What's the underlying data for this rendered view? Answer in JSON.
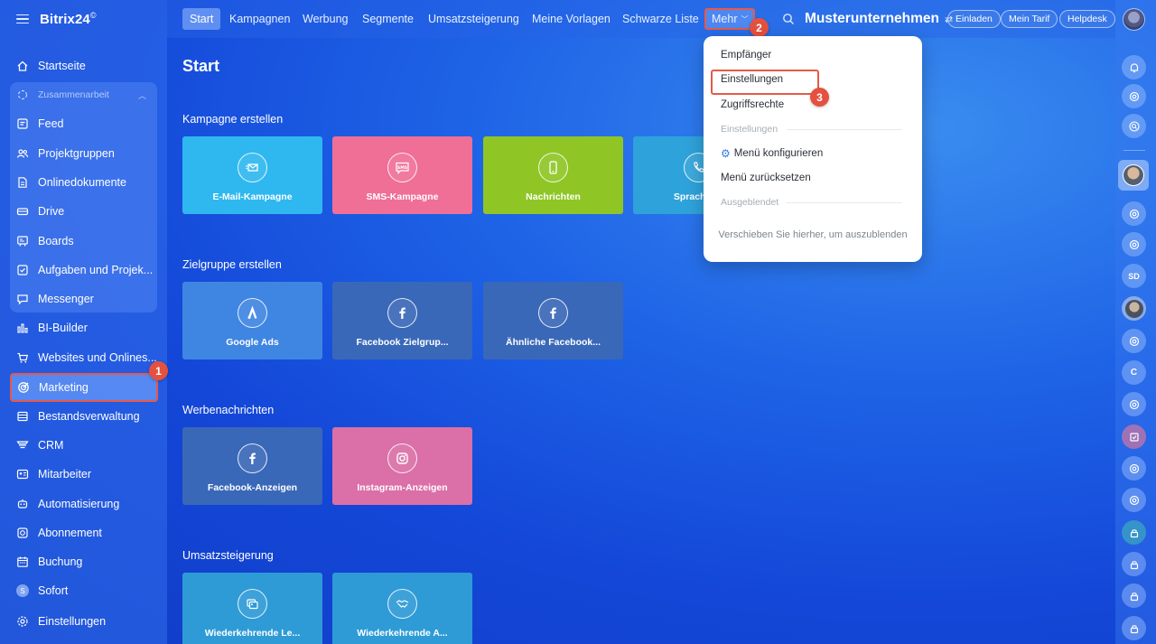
{
  "app": {
    "logo": "Bitrix24",
    "logo_mark": "©"
  },
  "sidebar": {
    "group_label": "Zusammenarbeit",
    "items": [
      {
        "label": "Startseite",
        "icon": "home-icon"
      },
      {
        "label": "Feed",
        "icon": "feed-icon"
      },
      {
        "label": "Projektgruppen",
        "icon": "groups-icon"
      },
      {
        "label": "Onlinedokumente",
        "icon": "document-icon"
      },
      {
        "label": "Drive",
        "icon": "drive-icon"
      },
      {
        "label": "Boards",
        "icon": "boards-icon"
      },
      {
        "label": "Aufgaben und Projek...",
        "icon": "tasks-icon"
      },
      {
        "label": "Messenger",
        "icon": "messenger-icon"
      },
      {
        "label": "BI-Builder",
        "icon": "chart-icon"
      },
      {
        "label": "Websites und Onlines...",
        "icon": "cart-icon"
      },
      {
        "label": "Marketing",
        "icon": "target-icon"
      },
      {
        "label": "Bestandsverwaltung",
        "icon": "inventory-icon"
      },
      {
        "label": "CRM",
        "icon": "crm-icon"
      },
      {
        "label": "Mitarbeiter",
        "icon": "employees-icon"
      },
      {
        "label": "Automatisierung",
        "icon": "robot-icon"
      },
      {
        "label": "Abonnement",
        "icon": "subscription-icon"
      },
      {
        "label": "Buchung",
        "icon": "calendar-icon"
      },
      {
        "label": "Sofort",
        "icon": "s-icon"
      },
      {
        "label": "Einstellungen",
        "icon": "gear-icon"
      }
    ],
    "s_badge": "S"
  },
  "topbar": {
    "tabs": [
      "Start",
      "Kampagnen",
      "Werbung",
      "Segmente",
      "Umsatzsteigerung",
      "Meine Vorlagen",
      "Schwarze Liste"
    ],
    "more_label": "Mehr",
    "company": "Musterunternehmen",
    "buttons": [
      "Einladen",
      "Mein Tarif",
      "Helpdesk"
    ]
  },
  "main": {
    "title": "Start",
    "sections": [
      {
        "title": "Kampagne erstellen",
        "tiles": [
          {
            "label": "E-Mail-Kampagne",
            "color": "#2fb8ef"
          },
          {
            "label": "SMS-Kampagne",
            "color": "#f06f97"
          },
          {
            "label": "Nachrichten",
            "color": "#8fc625"
          },
          {
            "label": "Sprachübe",
            "color": "#2ea3db"
          }
        ]
      },
      {
        "title": "Zielgruppe erstellen",
        "tiles": [
          {
            "label": "Google Ads",
            "color": "#3f86e2"
          },
          {
            "label": "Facebook Zielgrup...",
            "color": "#3a68b8"
          },
          {
            "label": "Ähnliche Facebook...",
            "color": "#3a68b8"
          }
        ]
      },
      {
        "title": "Werbenachrichten",
        "tiles": [
          {
            "label": "Facebook-Anzeigen",
            "color": "#3a68b8"
          },
          {
            "label": "Instagram-Anzeigen",
            "color": "#db6fa7"
          }
        ]
      },
      {
        "title": "Umsatzsteigerung",
        "tiles": [
          {
            "label": "Wiederkehrende Le...",
            "color": "#2e9bd6"
          },
          {
            "label": "Wiederkehrende A...",
            "color": "#2e9bd6"
          }
        ]
      }
    ]
  },
  "dropdown": {
    "items": [
      "Empfänger",
      "Einstellungen",
      "Zugriffsrechte"
    ],
    "section_settings": "Einstellungen",
    "configure": "Menü konfigurieren",
    "reset": "Menü zurücksetzen",
    "section_hidden": "Ausgeblendet",
    "hint": "Verschieben Sie hierher, um auszublenden"
  },
  "rail": {
    "letters": [
      "SD",
      "C"
    ]
  },
  "annotations": [
    "1",
    "2",
    "3"
  ]
}
